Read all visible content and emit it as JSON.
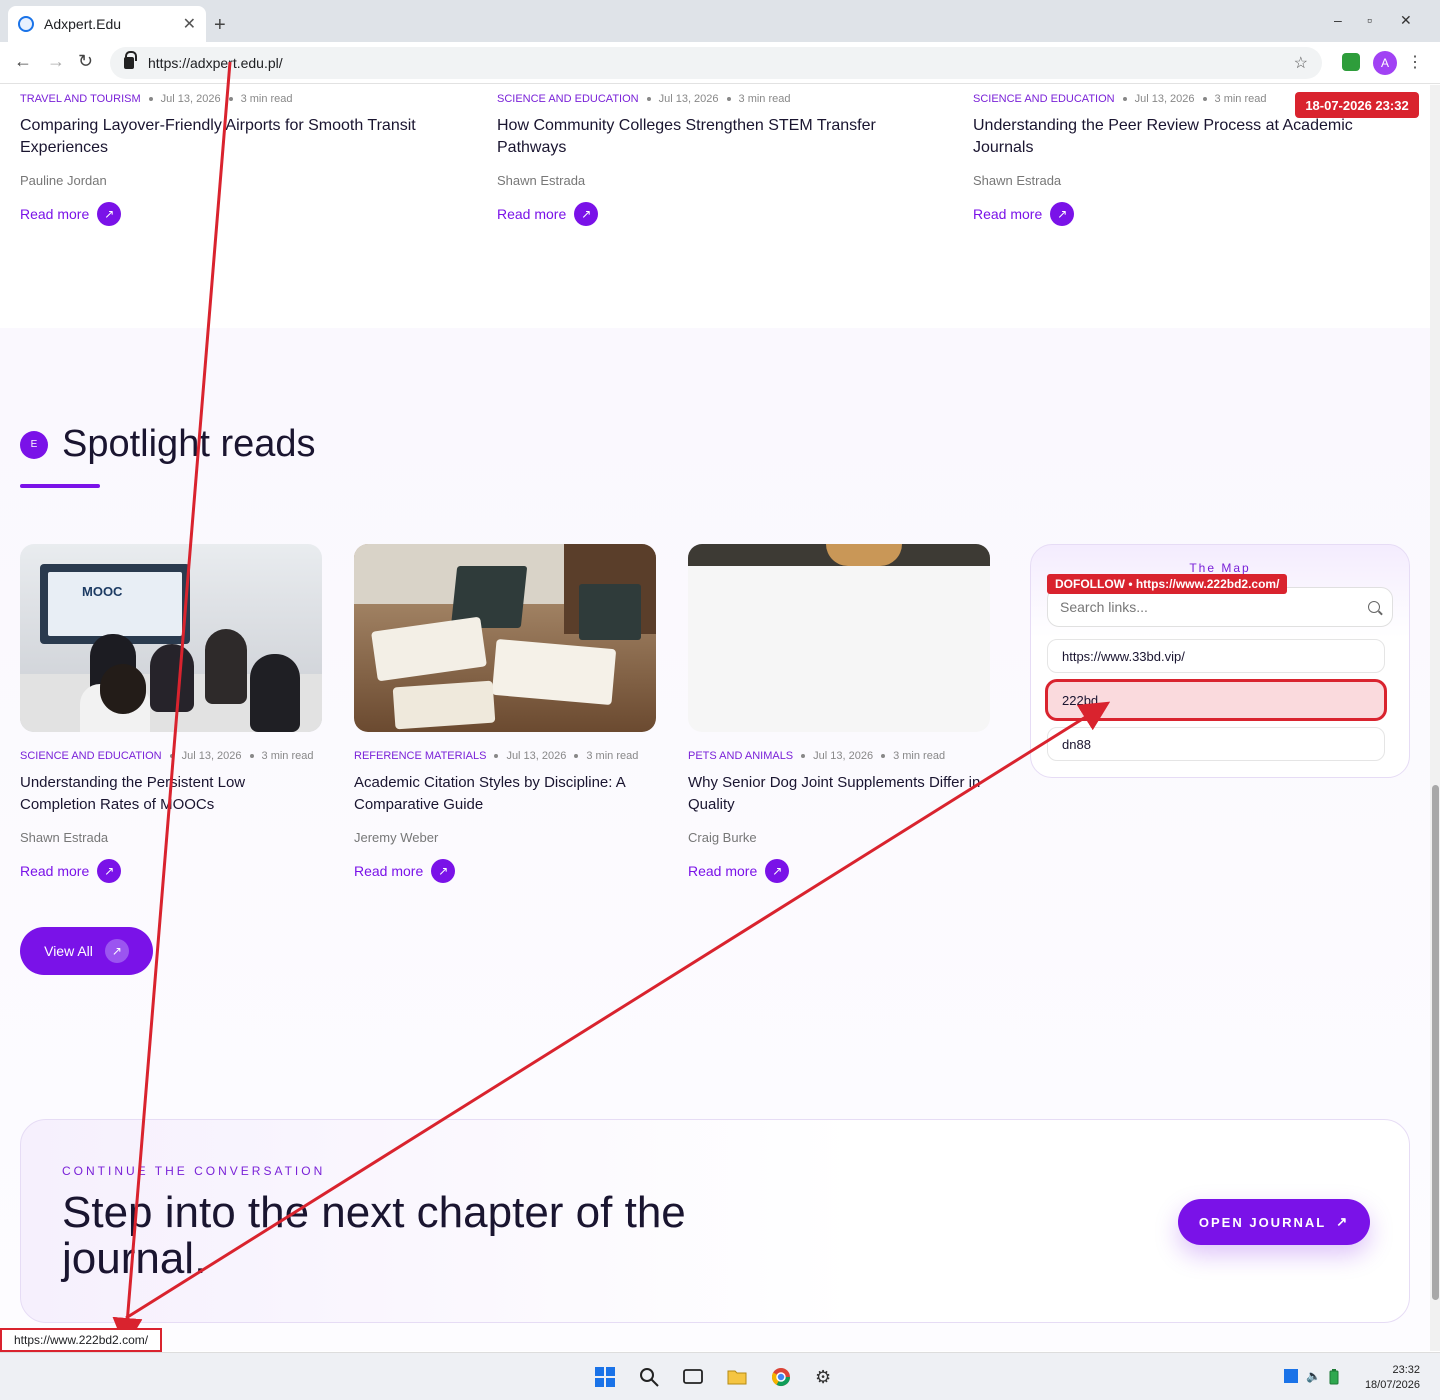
{
  "browser": {
    "tab_title": "Adxpert.Edu",
    "tab_close": "✕",
    "new_tab": "+",
    "url": "https://adxpert.edu.pl/",
    "minimize": "–",
    "maximize": "▫",
    "close": "✕",
    "back": "←",
    "forward": "→",
    "reload": "↻",
    "star": "☆",
    "profile_initial": "A",
    "menu": "⋮"
  },
  "top_cards": [
    {
      "category": "TRAVEL AND TOURISM",
      "date": "Jul 13, 2026",
      "read_time": "3 min read",
      "title": "Comparing Layover-Friendly Airports for Smooth Transit Experiences",
      "author": "Pauline Jordan",
      "read_more": "Read more"
    },
    {
      "category": "SCIENCE AND EDUCATION",
      "date": "Jul 13, 2026",
      "read_time": "3 min read",
      "title": "How Community Colleges Strengthen STEM Transfer Pathways",
      "author": "Shawn Estrada",
      "read_more": "Read more"
    },
    {
      "category": "SCIENCE AND EDUCATION",
      "date": "Jul 13, 2026",
      "read_time": "3 min read",
      "title": "Understanding the Peer Review Process at Academic Journals",
      "author": "Shawn Estrada",
      "read_more": "Read more"
    }
  ],
  "date_badge": "18-07-2026 23:32",
  "spotlight": {
    "badge": "E",
    "title": "Spotlight reads",
    "view_all": "View All",
    "cards": [
      {
        "category": "SCIENCE AND EDUCATION",
        "date": "Jul 13, 2026",
        "read_time": "3 min read",
        "title": "Understanding the Persistent Low Completion Rates of MOOCs",
        "author": "Shawn Estrada",
        "read_more": "Read more",
        "image_text": "MOOC"
      },
      {
        "category": "REFERENCE MATERIALS",
        "date": "Jul 13, 2026",
        "read_time": "3 min read",
        "title": "Academic Citation Styles by Discipline: A Comparative Guide",
        "author": "Jeremy Weber",
        "read_more": "Read more"
      },
      {
        "category": "PETS AND ANIMALS",
        "date": "Jul 13, 2026",
        "read_time": "3 min read",
        "title": "Why Senior Dog Joint Supplements Differ in Quality",
        "author": "Craig Burke",
        "read_more": "Read more"
      }
    ]
  },
  "map_widget": {
    "title": "The Map",
    "search_placeholder": "Search links...",
    "links": [
      "https://www.33bd.vip/",
      "222bd",
      "dn88"
    ],
    "dofollow_label": "DOFOLLOW • https://www.222bd2.com/"
  },
  "cta": {
    "kicker": "CONTINUE THE CONVERSATION",
    "title": "Step into the next chapter of the journal.",
    "button": "OPEN JOURNAL"
  },
  "status_bar_url": "https://www.222bd2.com/",
  "taskbar": {
    "time": "23:32",
    "date": "18/07/2026"
  },
  "colors": {
    "accent": "#7a12e8",
    "annotation_red": "#d9232e"
  }
}
